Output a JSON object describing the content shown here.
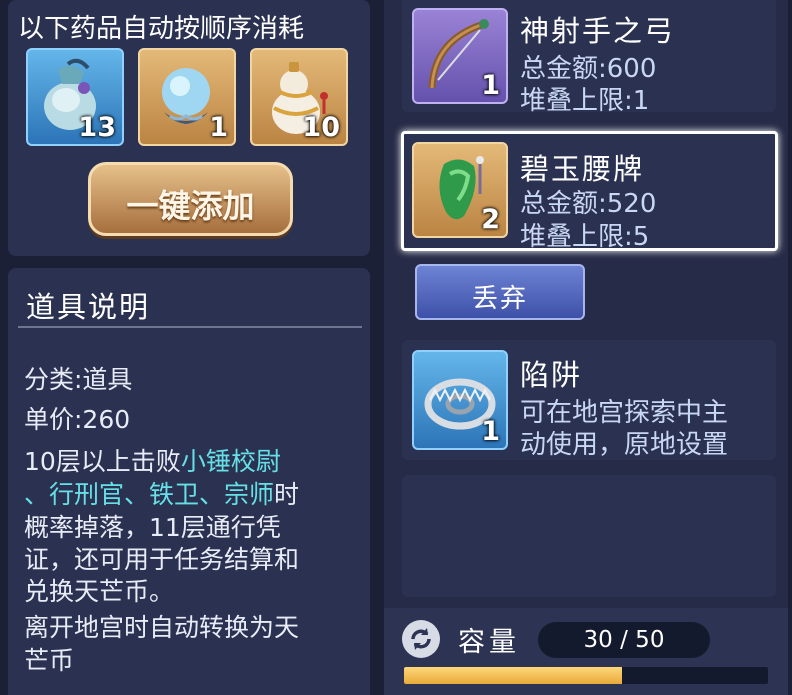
{
  "potion_panel": {
    "title": "以下药品自动按顺序消耗",
    "potions": [
      {
        "icon": "jade-vial-icon",
        "count": "13"
      },
      {
        "icon": "crystal-orb-icon",
        "count": "1"
      },
      {
        "icon": "gourd-icon",
        "count": "10"
      }
    ],
    "add_button": "一键添加"
  },
  "item_info": {
    "title": "道具说明",
    "category": "分类:道具",
    "unit_price": "单价:260",
    "desc": {
      "l1_a": "10层以上击败",
      "l1_b": "小锤校尉",
      "l2_a": "、行刑官、铁卫、宗师",
      "l2_b": "时",
      "l3": "概率掉落，11层通行凭",
      "l4": "证，还可用于任务结算和",
      "l5": "兑换天芒币。",
      "l6": "离开地宫时自动转换为天",
      "l7": "芒币"
    }
  },
  "inventory": {
    "items": [
      {
        "icon": "bow-icon",
        "name": "神射手之弓",
        "count": "1",
        "total": "总金额:600",
        "stack": "堆叠上限:1"
      },
      {
        "icon": "jade-pendant-icon",
        "name": "碧玉腰牌",
        "count": "2",
        "total": "总金额:520",
        "stack": "堆叠上限:5"
      },
      {
        "icon": "trap-icon",
        "name": "陷阱",
        "count": "1",
        "desc1": "可在地宫探索中主",
        "desc2": "动使用，原地设置"
      }
    ],
    "discard_button": "丢弃"
  },
  "capacity": {
    "label": "容量",
    "value": "30 / 50",
    "fraction": 0.6
  },
  "colors": {
    "accent_highlight": "#66e0e6",
    "capacity_fill": "#f2c35a",
    "selected_border": "#ffffff"
  }
}
